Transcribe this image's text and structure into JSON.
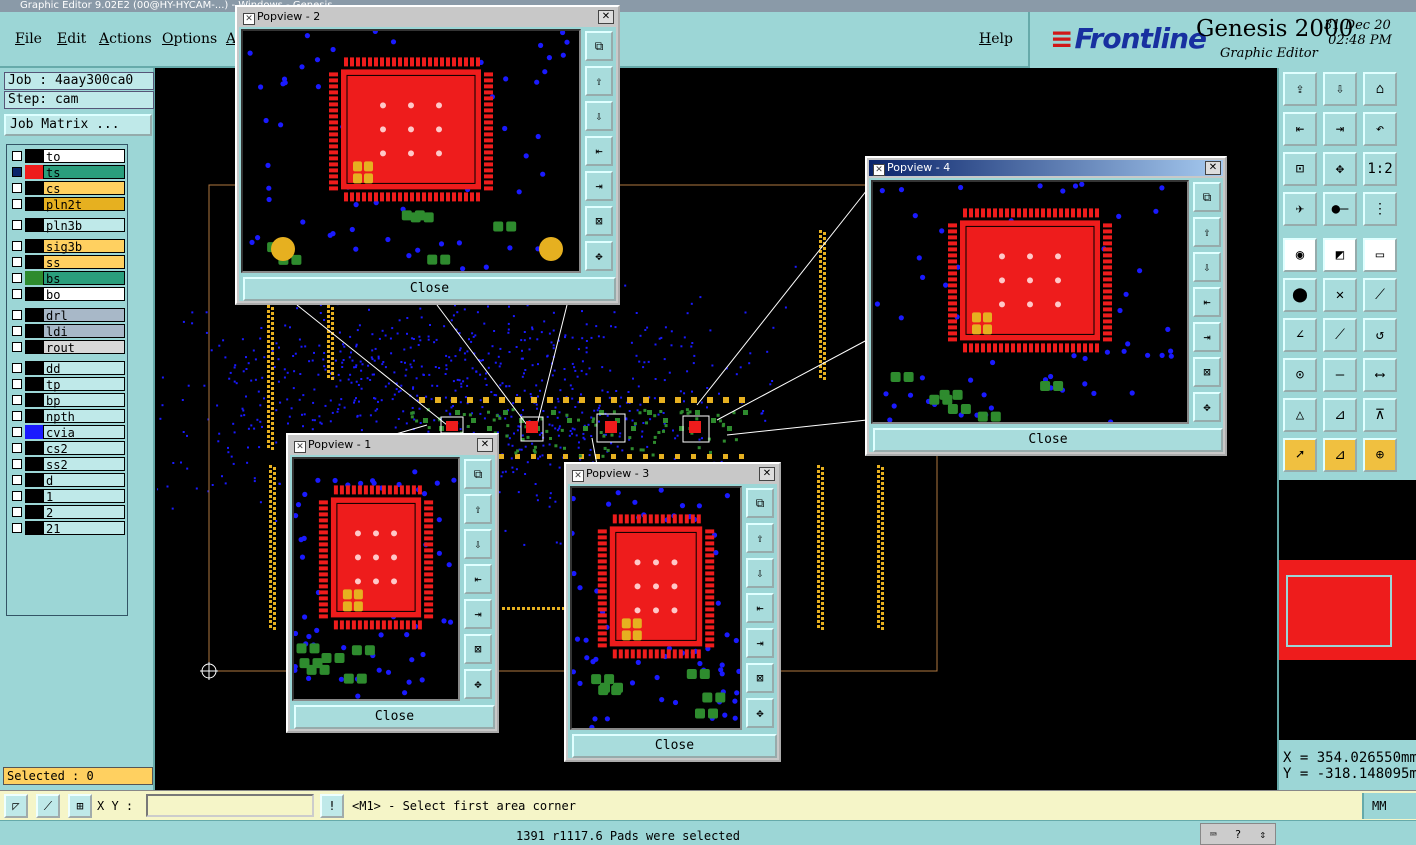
{
  "window": {
    "title": "Graphic Editor 9.02E2 (00@HY-HYCAM-...) - Windows - Genesis"
  },
  "menu": {
    "items": [
      "File",
      "Edit",
      "Actions",
      "Options",
      "A"
    ],
    "help": "Help"
  },
  "brand": {
    "logo": "Frontline",
    "product": "Genesis 2000",
    "subtitle": "Graphic Editor",
    "date": "31 Dec 20",
    "time": "02:48 PM"
  },
  "job": {
    "job_label": "Job : 4aay300ca0",
    "step_label": "Step: cam",
    "matrix_button": "Job Matrix ..."
  },
  "layers": [
    {
      "name": "to",
      "swatch": "#000000",
      "bg": "#ffffff"
    },
    {
      "name": "ts",
      "swatch": "#ee1c1c",
      "bg": "#2a9e7c",
      "active": true
    },
    {
      "name": "cs",
      "swatch": "#000000",
      "bg": "#ffd060"
    },
    {
      "name": "pln2t",
      "swatch": "#000000",
      "bg": "#e6b020"
    },
    {
      "name": "pln3b",
      "swatch": "#000000",
      "bg": "#bfe9e9"
    },
    {
      "name": "sig3b",
      "swatch": "#000000",
      "bg": "#ffd060"
    },
    {
      "name": "ss",
      "swatch": "#000000",
      "bg": "#ffd060"
    },
    {
      "name": "bs",
      "swatch": "#2e8b2e",
      "bg": "#2a9e7c"
    },
    {
      "name": "bo",
      "swatch": "#000000",
      "bg": "#ffffff"
    },
    {
      "name": "drl",
      "swatch": "#000000",
      "bg": "#a8b8c8"
    },
    {
      "name": "ldi",
      "swatch": "#000000",
      "bg": "#a8b8c8"
    },
    {
      "name": "rout",
      "swatch": "#000000",
      "bg": "#d8d8d8"
    },
    {
      "name": "dd",
      "swatch": "#000000",
      "bg": "#bfe9e9"
    },
    {
      "name": "tp",
      "swatch": "#000000",
      "bg": "#bfe9e9"
    },
    {
      "name": "bp",
      "swatch": "#000000",
      "bg": "#bfe9e9"
    },
    {
      "name": "npth",
      "swatch": "#000000",
      "bg": "#bfe9e9"
    },
    {
      "name": "cvia",
      "swatch": "#1a1aff",
      "bg": "#bfe9e9"
    },
    {
      "name": "cs2",
      "swatch": "#000000",
      "bg": "#bfe9e9"
    },
    {
      "name": "ss2",
      "swatch": "#000000",
      "bg": "#bfe9e9"
    },
    {
      "name": "d",
      "swatch": "#000000",
      "bg": "#bfe9e9"
    },
    {
      "name": "1",
      "swatch": "#000000",
      "bg": "#bfe9e9"
    },
    {
      "name": "2",
      "swatch": "#000000",
      "bg": "#bfe9e9"
    },
    {
      "name": "21",
      "swatch": "#000000",
      "bg": "#bfe9e9"
    }
  ],
  "selected": "Selected : 0",
  "popviews": [
    {
      "title": "Popview - 2",
      "close": "Close"
    },
    {
      "title": "Popview - 4",
      "close": "Close"
    },
    {
      "title": "Popview - 1",
      "close": "Close"
    },
    {
      "title": "Popview - 3",
      "close": "Close"
    }
  ],
  "tools": {
    "grid_labels": [
      "1:2"
    ],
    "icons": [
      "zoom-home-icon",
      "zoom-back-icon",
      "home-icon",
      "pan-left-icon",
      "pan-right-icon",
      "zoom-fit-icon",
      "center-icon",
      "ratio-icon",
      "measure-icon",
      "snap-icon",
      "pin-icon",
      "select-icon",
      "pad-icon",
      "ruler-icon",
      "line-icon",
      "cross-icon",
      "arc-icon",
      "angle-icon",
      "rotate-icon",
      "arrow-icon"
    ]
  },
  "coords": {
    "x": "X = 354.026550mm",
    "y": "Y = -318.148095mm"
  },
  "cmd": {
    "xy_label": "X Y :",
    "xy_value": "",
    "prompt": "<M1> - Select first area corner",
    "unit": "MM"
  },
  "status": {
    "message": "1391 r1117.6 Pads were selected"
  },
  "colors": {
    "panel": "#9cd6d6",
    "pad": "#ee1c1c",
    "via": "#1a1aff",
    "smd": "#2e8b2e",
    "gold": "#e6b020"
  }
}
